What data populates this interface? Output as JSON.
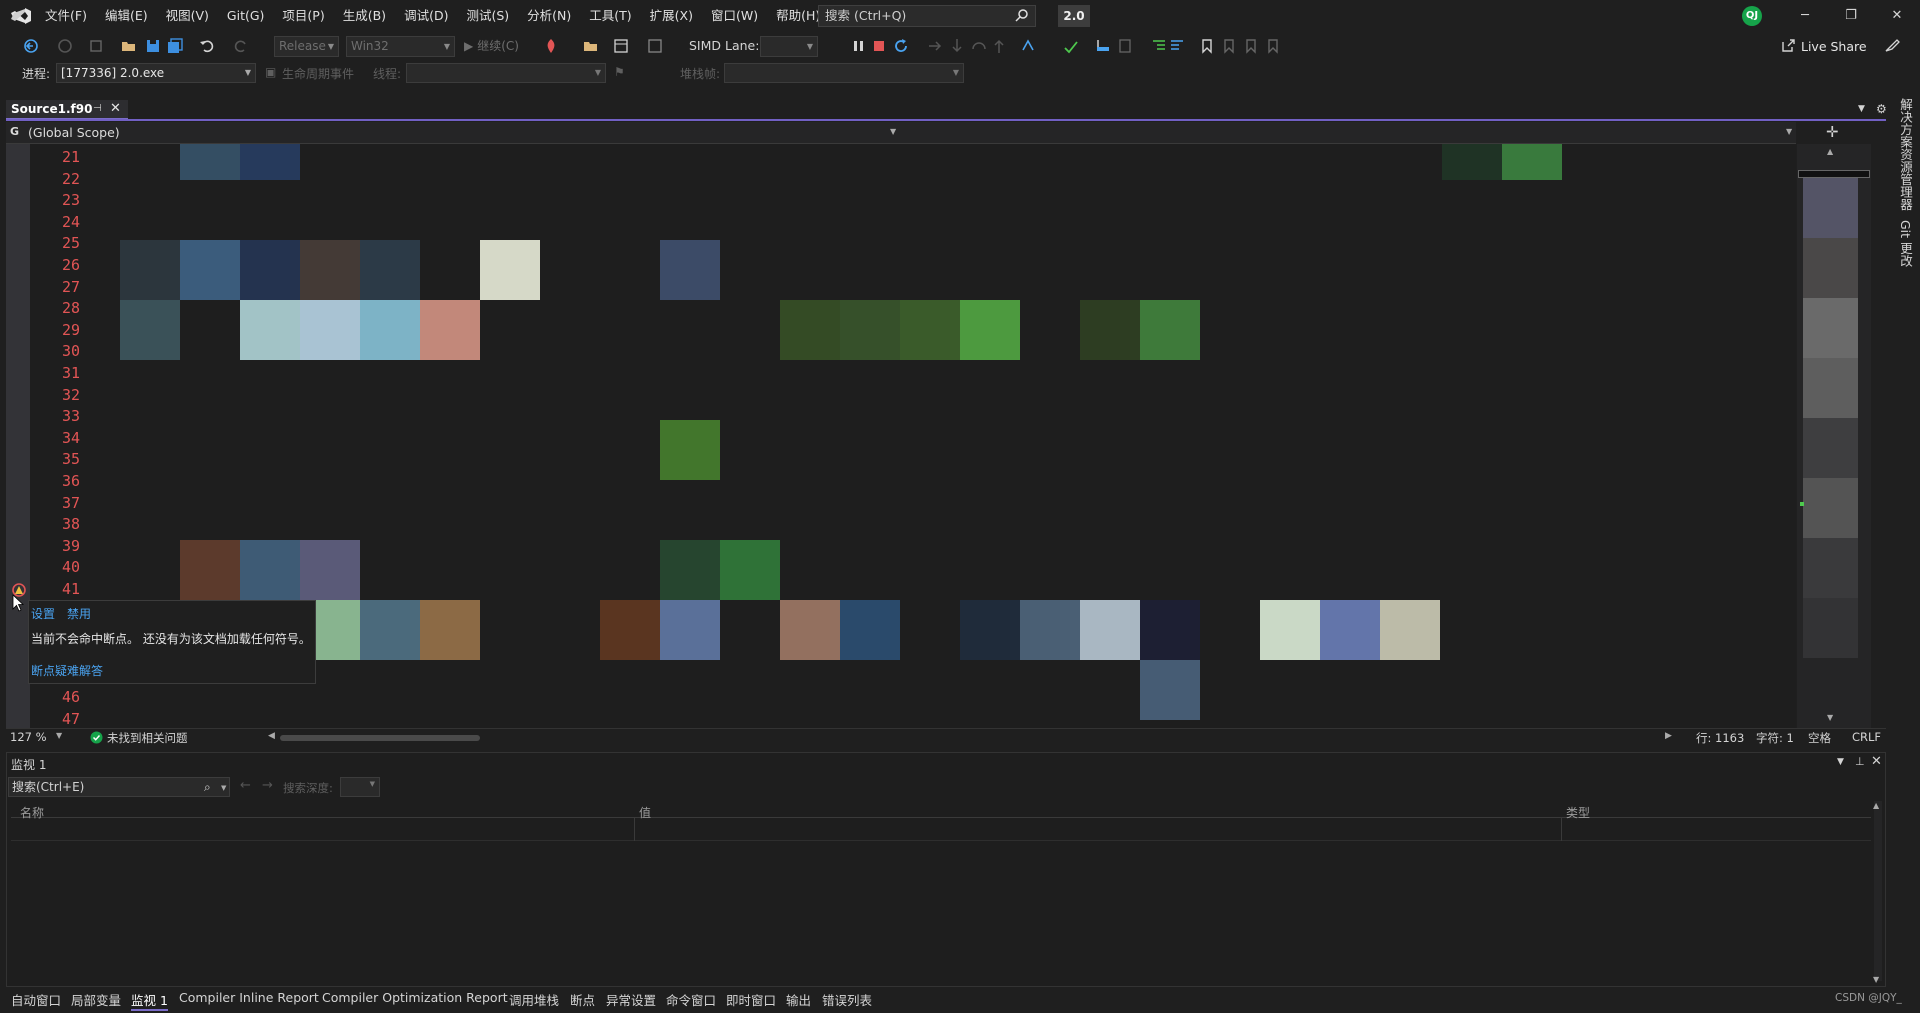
{
  "menu": [
    "文件(F)",
    "编辑(E)",
    "视图(V)",
    "Git(G)",
    "项目(P)",
    "生成(B)",
    "调试(D)",
    "测试(S)",
    "分析(N)",
    "工具(T)",
    "扩展(X)",
    "窗口(W)",
    "帮助(H)"
  ],
  "search": {
    "text": "搜索 (Ctrl+Q)"
  },
  "config_badge": "2.0",
  "avatar": "QJ",
  "toolbar": {
    "config": "Release",
    "platform": "Win32",
    "continue": "继续(C)",
    "simd_label": "SIMD Lane:",
    "live_share": "Live Share"
  },
  "debug_bar": {
    "process_label": "进程:",
    "process_value": "[177336] 2.0.exe",
    "lifecycle": "生命周期事件",
    "thread_label": "线程:",
    "stack_label": "堆栈帧:"
  },
  "doc_tab": {
    "name": "Source1.f90"
  },
  "scope": {
    "g": "G",
    "text": "(Global Scope)"
  },
  "line_numbers": [
    "21",
    "22",
    "23",
    "24",
    "25",
    "26",
    "27",
    "28",
    "29",
    "30",
    "31",
    "32",
    "33",
    "34",
    "35",
    "36",
    "37",
    "38",
    "39",
    "40",
    "41",
    "46",
    "47"
  ],
  "tooltip": {
    "settings": "设置",
    "disable": "禁用",
    "message": "当前不会命中断点。 还没有为该文档加载任何符号。",
    "troubleshoot": "断点疑难解答"
  },
  "side_panels": [
    "解决方案资源管理器",
    "Git 更改"
  ],
  "editor_status": {
    "zoom": "127 %",
    "issues": "未找到相关问题",
    "line": "行: 1163",
    "char": "字符: 1",
    "whitespace": "空格",
    "eol": "CRLF"
  },
  "watch": {
    "title": "监视 1",
    "search_placeholder": "搜索(Ctrl+E)",
    "depth_label": "搜索深度:",
    "columns": [
      "名称",
      "值",
      "类型"
    ]
  },
  "bottom_tabs": [
    "自动窗口",
    "局部变量",
    "监视 1",
    "Compiler Inline Report",
    "Compiler Optimization Report",
    "调用堆栈",
    "断点",
    "异常设置",
    "命令窗口",
    "即时窗口",
    "输出",
    "错误列表"
  ],
  "watermark": "CSDN @JQY_",
  "colors": {
    "accent": "#7b6cc8",
    "line_numbers": "#e25555",
    "link": "#4aa3f0"
  }
}
